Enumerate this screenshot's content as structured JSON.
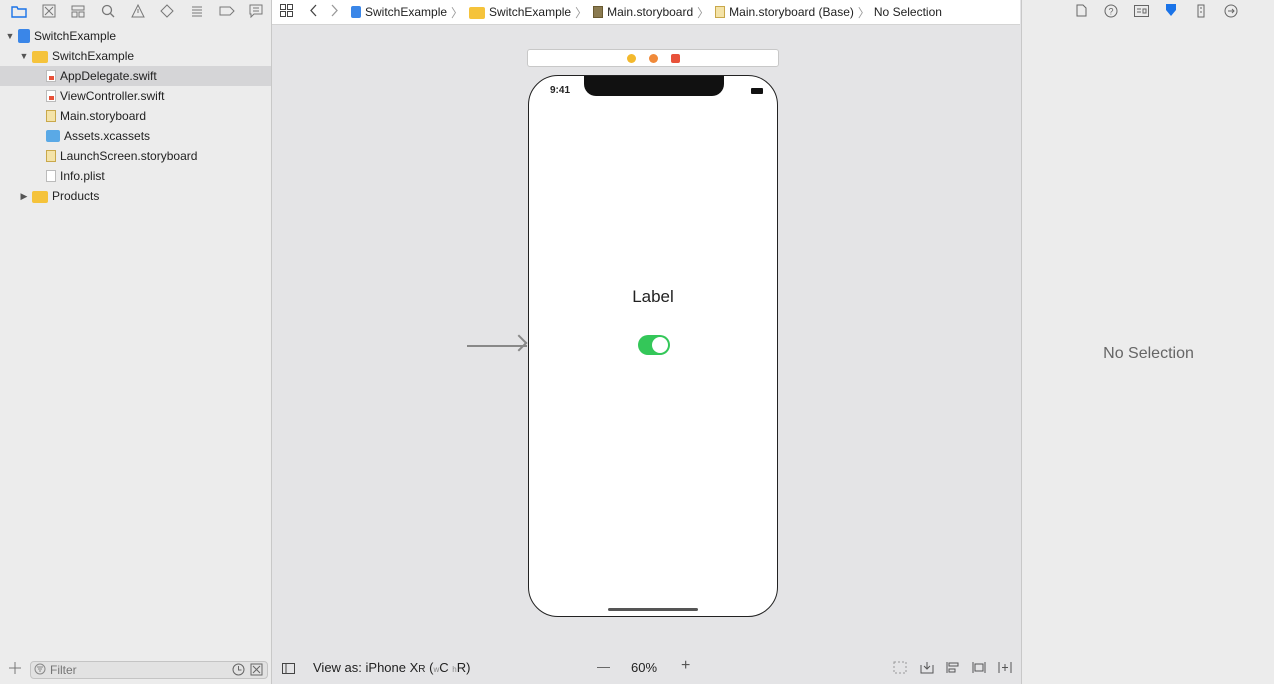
{
  "navigator": {
    "tabs": [
      "folder-icon",
      "source-control-icon",
      "symbol-icon",
      "find-icon",
      "issue-icon",
      "test-icon",
      "debug-icon",
      "breakpoint-icon",
      "report-icon"
    ],
    "tree": [
      {
        "label": "SwitchExample",
        "kind": "proj",
        "expanded": "open",
        "indent": 0
      },
      {
        "label": "SwitchExample",
        "kind": "folder",
        "expanded": "open",
        "indent": 1
      },
      {
        "label": "AppDelegate.swift",
        "kind": "swift",
        "indent": 2,
        "selected": true
      },
      {
        "label": "ViewController.swift",
        "kind": "swift",
        "indent": 2
      },
      {
        "label": "Main.storyboard",
        "kind": "story",
        "indent": 2
      },
      {
        "label": "Assets.xcassets",
        "kind": "assets",
        "indent": 2
      },
      {
        "label": "LaunchScreen.storyboard",
        "kind": "story",
        "indent": 2
      },
      {
        "label": "Info.plist",
        "kind": "doc",
        "indent": 2
      },
      {
        "label": "Products",
        "kind": "folder",
        "expanded": "closed",
        "indent": 1
      }
    ],
    "filter_placeholder": "Filter"
  },
  "jumpbar": {
    "crumbs": [
      "SwitchExample",
      "SwitchExample",
      "Main.storyboard",
      "Main.storyboard (Base)",
      "No Selection"
    ]
  },
  "canvas": {
    "status_time": "9:41",
    "label_text": "Label",
    "switch_on": true,
    "accent": "#34c759"
  },
  "bottom_bar": {
    "view_as": "View as: iPhone X",
    "view_as_r": "R",
    "size_class_w": "w",
    "size_class_wv": "C",
    "size_class_h": "h",
    "size_class_hv": "R",
    "zoom": "60%",
    "zoom_out": "—",
    "zoom_in": "+"
  },
  "inspector": {
    "tabs": [
      "file-inspector-icon",
      "help-icon",
      "identity-icon",
      "attributes-icon",
      "size-icon",
      "connections-icon"
    ],
    "empty_text": "No Selection"
  }
}
